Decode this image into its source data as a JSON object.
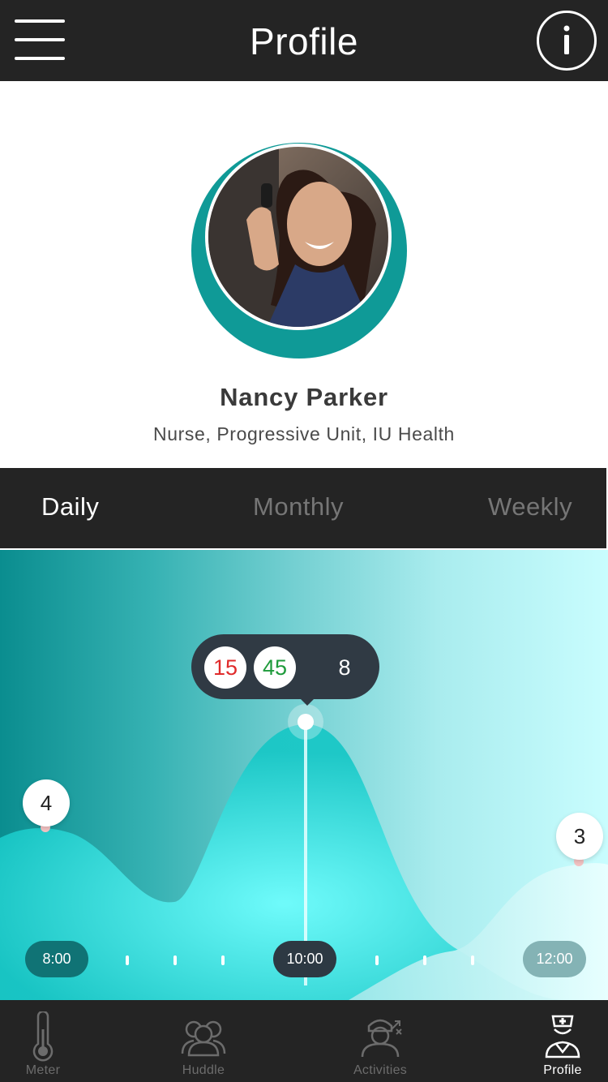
{
  "header": {
    "title": "Profile",
    "menu_icon": "hamburger-menu-icon",
    "info_icon": "info-circle-icon"
  },
  "profile": {
    "name": "Nancy Parker",
    "role": "Nurse, Progressive Unit, IU Health",
    "ring_color": "#0f9a97"
  },
  "tabs": [
    {
      "label": "Daily",
      "active": true
    },
    {
      "label": "Monthly",
      "active": false
    },
    {
      "label": "Weekly",
      "active": false
    }
  ],
  "chart": {
    "left_marker": "4",
    "right_marker": "3",
    "tooltip": {
      "red_value": "15",
      "green_value": "45",
      "plain_value": "8"
    },
    "times": [
      "8:00",
      "10:00",
      "12:00"
    ],
    "selected_time": "10:00",
    "colors": {
      "red": "#e02b2b",
      "green": "#1f9b3c",
      "tooltip_bg": "#303a44"
    }
  },
  "bottom_nav": [
    {
      "label": "Meter",
      "icon": "thermometer-icon",
      "active": false
    },
    {
      "label": "Huddle",
      "icon": "group-icon",
      "active": false
    },
    {
      "label": "Activities",
      "icon": "person-activities-icon",
      "active": false
    },
    {
      "label": "Profile",
      "icon": "nurse-icon",
      "active": true
    }
  ]
}
